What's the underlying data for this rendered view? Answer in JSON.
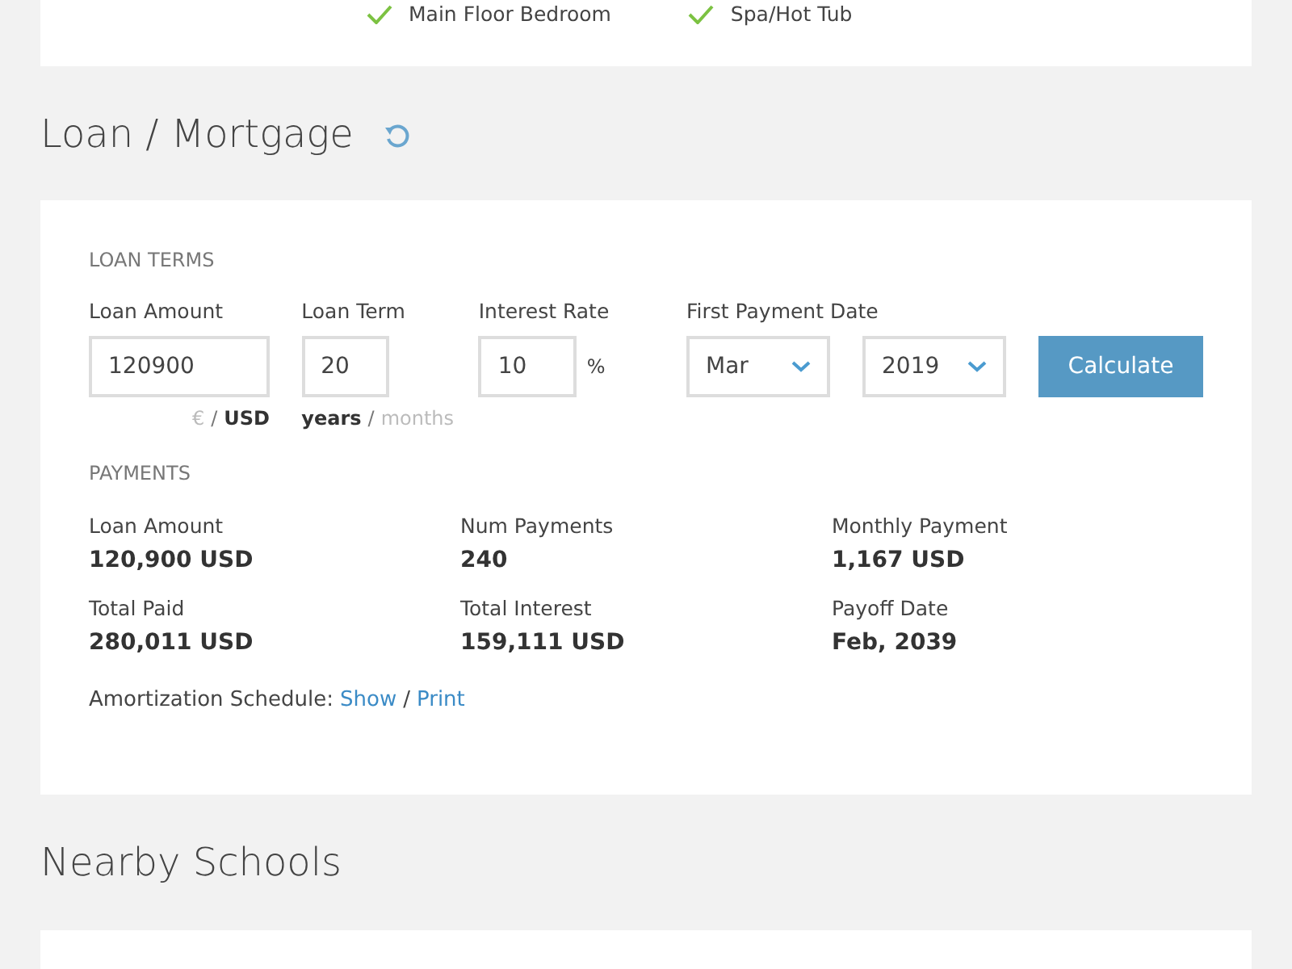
{
  "features": [
    {
      "label": "Main Floor Bedroom",
      "checked": true
    },
    {
      "label": "Spa/Hot Tub",
      "checked": true
    }
  ],
  "loan_section": {
    "title": "Loan / Mortgage",
    "terms_heading": "LOAN TERMS",
    "loan_amount": {
      "label": "Loan Amount",
      "value": "120900",
      "units": [
        {
          "label": "€",
          "selected": false
        },
        {
          "label": "USD",
          "selected": true
        }
      ],
      "separator": "/"
    },
    "loan_term": {
      "label": "Loan Term",
      "value": "20",
      "units": [
        {
          "label": "years",
          "selected": true
        },
        {
          "label": "months",
          "selected": false
        }
      ],
      "separator": "/"
    },
    "interest_rate": {
      "label": "Interest Rate",
      "value": "10",
      "suffix": "%"
    },
    "first_payment": {
      "label": "First Payment Date",
      "month": "Mar",
      "year": "2019"
    },
    "calculate_button": "Calculate",
    "payments_heading": "PAYMENTS",
    "payments": [
      {
        "label": "Loan Amount",
        "value": "120,900 USD"
      },
      {
        "label": "Num Payments",
        "value": "240"
      },
      {
        "label": "Monthly Payment",
        "value": "1,167 USD"
      },
      {
        "label": "Total Paid",
        "value": "280,011 USD"
      },
      {
        "label": "Total Interest",
        "value": "159,111 USD"
      },
      {
        "label": "Payoff Date",
        "value": "Feb, 2039"
      }
    ],
    "amortization": {
      "label": "Amortization Schedule:",
      "links": [
        "Show",
        "Print"
      ],
      "separator": "/"
    }
  },
  "schools_section": {
    "title": "Nearby Schools"
  }
}
